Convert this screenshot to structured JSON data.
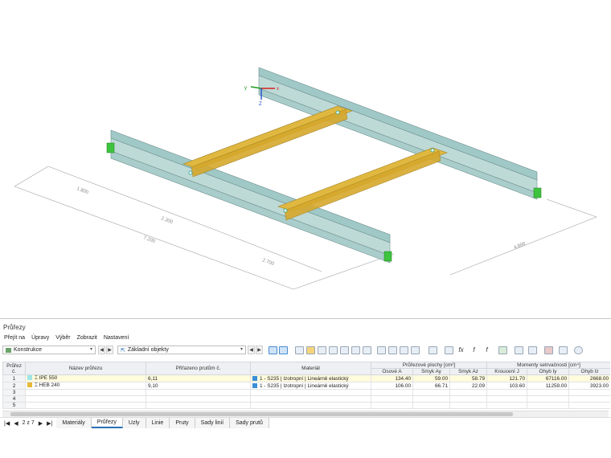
{
  "viewport": {
    "axis": {
      "x": "x",
      "y": "y",
      "z": "Z"
    },
    "dimensions": [
      "1.800",
      "2.300",
      "7.200",
      "2.700",
      "4.800"
    ]
  },
  "panel": {
    "title": "Průřezy",
    "menu": [
      "Přejít na",
      "Úpravy",
      "Výběr",
      "Zobrazit",
      "Nastavení"
    ],
    "combo_left": "Konstrukce",
    "combo_right": "Základní objekty"
  },
  "table": {
    "group_headers": {
      "areas": "Průřezové plochy [cm²]",
      "moments": "Momenty setrvačnosti [cm⁴]"
    },
    "headers": {
      "no": "Průřez č.",
      "name": "Název průřezu",
      "assigned": "Přiřazeno prutům č.",
      "material": "Materiál",
      "axial": "Osové A",
      "shear_y": "Smyk Ay",
      "shear_z": "Smyk Az",
      "torsion": "Kroucení J",
      "bend_y": "Ohyb Iy",
      "bend_z": "Ohyb Iz"
    },
    "rows": [
      {
        "no": "1",
        "color": "#9ee6e6",
        "name": "IPE 550",
        "assigned": "6,11",
        "material_color": "#3a8fd8",
        "material": "1 - S235 | Izotropní | Lineárně elastický",
        "axial": "134.40",
        "shear_y": "59.00",
        "shear_z": "58.79",
        "torsion": "121.70",
        "bend_y": "67116.00",
        "bend_z": "2668.00"
      },
      {
        "no": "2",
        "color": "#e8b838",
        "name": "HEB 240",
        "assigned": "9,10",
        "material_color": "#3a8fd8",
        "material": "1 - S235 | Izotropní | Lineárně elastický",
        "axial": "106.00",
        "shear_y": "66.71",
        "shear_z": "22.09",
        "torsion": "103.60",
        "bend_y": "11259.00",
        "bend_z": "3923.00"
      },
      {
        "no": "3"
      },
      {
        "no": "4"
      },
      {
        "no": "5"
      }
    ]
  },
  "tabs": {
    "pager": "2 z 7",
    "items": [
      "Materiály",
      "Průřezy",
      "Uzly",
      "Linie",
      "Pruty",
      "Sady linií",
      "Sady prutů"
    ],
    "active": "Průřezy"
  }
}
